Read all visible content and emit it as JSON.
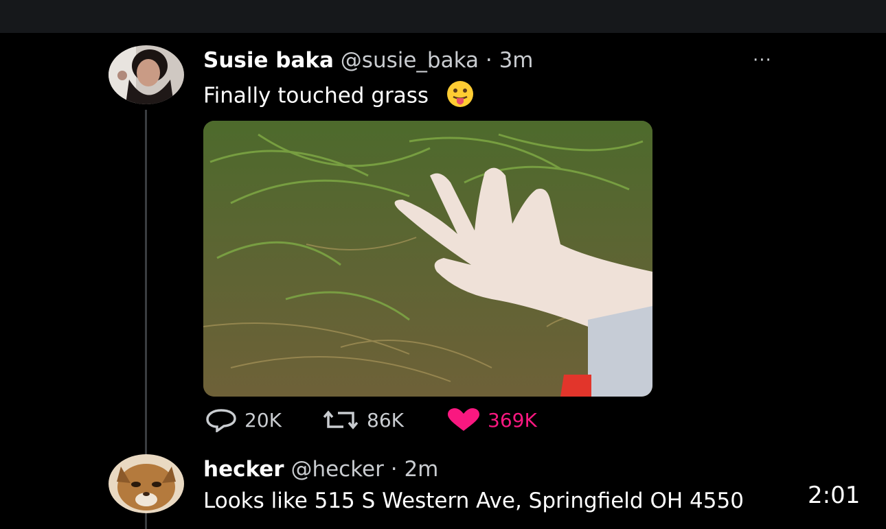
{
  "tweet1": {
    "name": "Susie baka",
    "handle": "@susie_baka",
    "time": "· 3m",
    "text": "Finally touched grass",
    "emoji_icon": "tongue-out-face-emoji",
    "more": "···",
    "actions": {
      "replies": "20K",
      "retweets": "86K",
      "likes": "369K"
    }
  },
  "tweet2": {
    "name": "hecker",
    "handle": "@hecker",
    "time": "· 2m",
    "text": "Looks like 515 S Western Ave, Springfield OH 4550"
  },
  "video_timestamp": "2:01",
  "colors": {
    "background": "#000000",
    "like_pink": "#f91880",
    "muted_text": "#c9ccd0"
  }
}
